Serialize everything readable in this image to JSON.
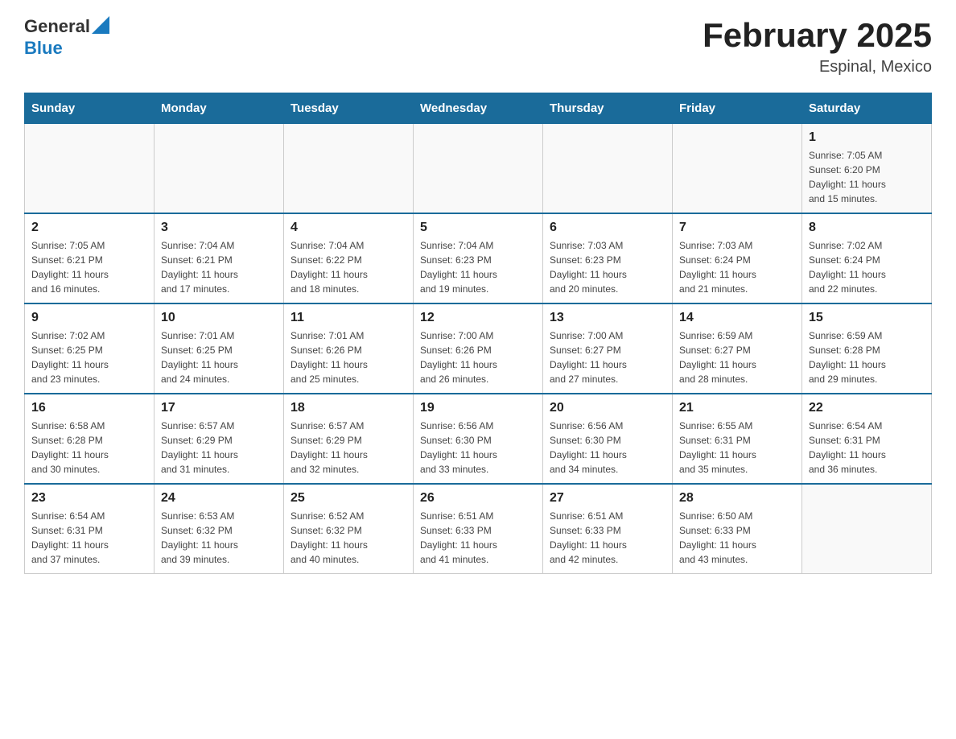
{
  "header": {
    "logo_general": "General",
    "logo_blue": "Blue",
    "title": "February 2025",
    "subtitle": "Espinal, Mexico"
  },
  "weekdays": [
    "Sunday",
    "Monday",
    "Tuesday",
    "Wednesday",
    "Thursday",
    "Friday",
    "Saturday"
  ],
  "weeks": [
    [
      {
        "day": "",
        "info": ""
      },
      {
        "day": "",
        "info": ""
      },
      {
        "day": "",
        "info": ""
      },
      {
        "day": "",
        "info": ""
      },
      {
        "day": "",
        "info": ""
      },
      {
        "day": "",
        "info": ""
      },
      {
        "day": "1",
        "info": "Sunrise: 7:05 AM\nSunset: 6:20 PM\nDaylight: 11 hours\nand 15 minutes."
      }
    ],
    [
      {
        "day": "2",
        "info": "Sunrise: 7:05 AM\nSunset: 6:21 PM\nDaylight: 11 hours\nand 16 minutes."
      },
      {
        "day": "3",
        "info": "Sunrise: 7:04 AM\nSunset: 6:21 PM\nDaylight: 11 hours\nand 17 minutes."
      },
      {
        "day": "4",
        "info": "Sunrise: 7:04 AM\nSunset: 6:22 PM\nDaylight: 11 hours\nand 18 minutes."
      },
      {
        "day": "5",
        "info": "Sunrise: 7:04 AM\nSunset: 6:23 PM\nDaylight: 11 hours\nand 19 minutes."
      },
      {
        "day": "6",
        "info": "Sunrise: 7:03 AM\nSunset: 6:23 PM\nDaylight: 11 hours\nand 20 minutes."
      },
      {
        "day": "7",
        "info": "Sunrise: 7:03 AM\nSunset: 6:24 PM\nDaylight: 11 hours\nand 21 minutes."
      },
      {
        "day": "8",
        "info": "Sunrise: 7:02 AM\nSunset: 6:24 PM\nDaylight: 11 hours\nand 22 minutes."
      }
    ],
    [
      {
        "day": "9",
        "info": "Sunrise: 7:02 AM\nSunset: 6:25 PM\nDaylight: 11 hours\nand 23 minutes."
      },
      {
        "day": "10",
        "info": "Sunrise: 7:01 AM\nSunset: 6:25 PM\nDaylight: 11 hours\nand 24 minutes."
      },
      {
        "day": "11",
        "info": "Sunrise: 7:01 AM\nSunset: 6:26 PM\nDaylight: 11 hours\nand 25 minutes."
      },
      {
        "day": "12",
        "info": "Sunrise: 7:00 AM\nSunset: 6:26 PM\nDaylight: 11 hours\nand 26 minutes."
      },
      {
        "day": "13",
        "info": "Sunrise: 7:00 AM\nSunset: 6:27 PM\nDaylight: 11 hours\nand 27 minutes."
      },
      {
        "day": "14",
        "info": "Sunrise: 6:59 AM\nSunset: 6:27 PM\nDaylight: 11 hours\nand 28 minutes."
      },
      {
        "day": "15",
        "info": "Sunrise: 6:59 AM\nSunset: 6:28 PM\nDaylight: 11 hours\nand 29 minutes."
      }
    ],
    [
      {
        "day": "16",
        "info": "Sunrise: 6:58 AM\nSunset: 6:28 PM\nDaylight: 11 hours\nand 30 minutes."
      },
      {
        "day": "17",
        "info": "Sunrise: 6:57 AM\nSunset: 6:29 PM\nDaylight: 11 hours\nand 31 minutes."
      },
      {
        "day": "18",
        "info": "Sunrise: 6:57 AM\nSunset: 6:29 PM\nDaylight: 11 hours\nand 32 minutes."
      },
      {
        "day": "19",
        "info": "Sunrise: 6:56 AM\nSunset: 6:30 PM\nDaylight: 11 hours\nand 33 minutes."
      },
      {
        "day": "20",
        "info": "Sunrise: 6:56 AM\nSunset: 6:30 PM\nDaylight: 11 hours\nand 34 minutes."
      },
      {
        "day": "21",
        "info": "Sunrise: 6:55 AM\nSunset: 6:31 PM\nDaylight: 11 hours\nand 35 minutes."
      },
      {
        "day": "22",
        "info": "Sunrise: 6:54 AM\nSunset: 6:31 PM\nDaylight: 11 hours\nand 36 minutes."
      }
    ],
    [
      {
        "day": "23",
        "info": "Sunrise: 6:54 AM\nSunset: 6:31 PM\nDaylight: 11 hours\nand 37 minutes."
      },
      {
        "day": "24",
        "info": "Sunrise: 6:53 AM\nSunset: 6:32 PM\nDaylight: 11 hours\nand 39 minutes."
      },
      {
        "day": "25",
        "info": "Sunrise: 6:52 AM\nSunset: 6:32 PM\nDaylight: 11 hours\nand 40 minutes."
      },
      {
        "day": "26",
        "info": "Sunrise: 6:51 AM\nSunset: 6:33 PM\nDaylight: 11 hours\nand 41 minutes."
      },
      {
        "day": "27",
        "info": "Sunrise: 6:51 AM\nSunset: 6:33 PM\nDaylight: 11 hours\nand 42 minutes."
      },
      {
        "day": "28",
        "info": "Sunrise: 6:50 AM\nSunset: 6:33 PM\nDaylight: 11 hours\nand 43 minutes."
      },
      {
        "day": "",
        "info": ""
      }
    ]
  ]
}
